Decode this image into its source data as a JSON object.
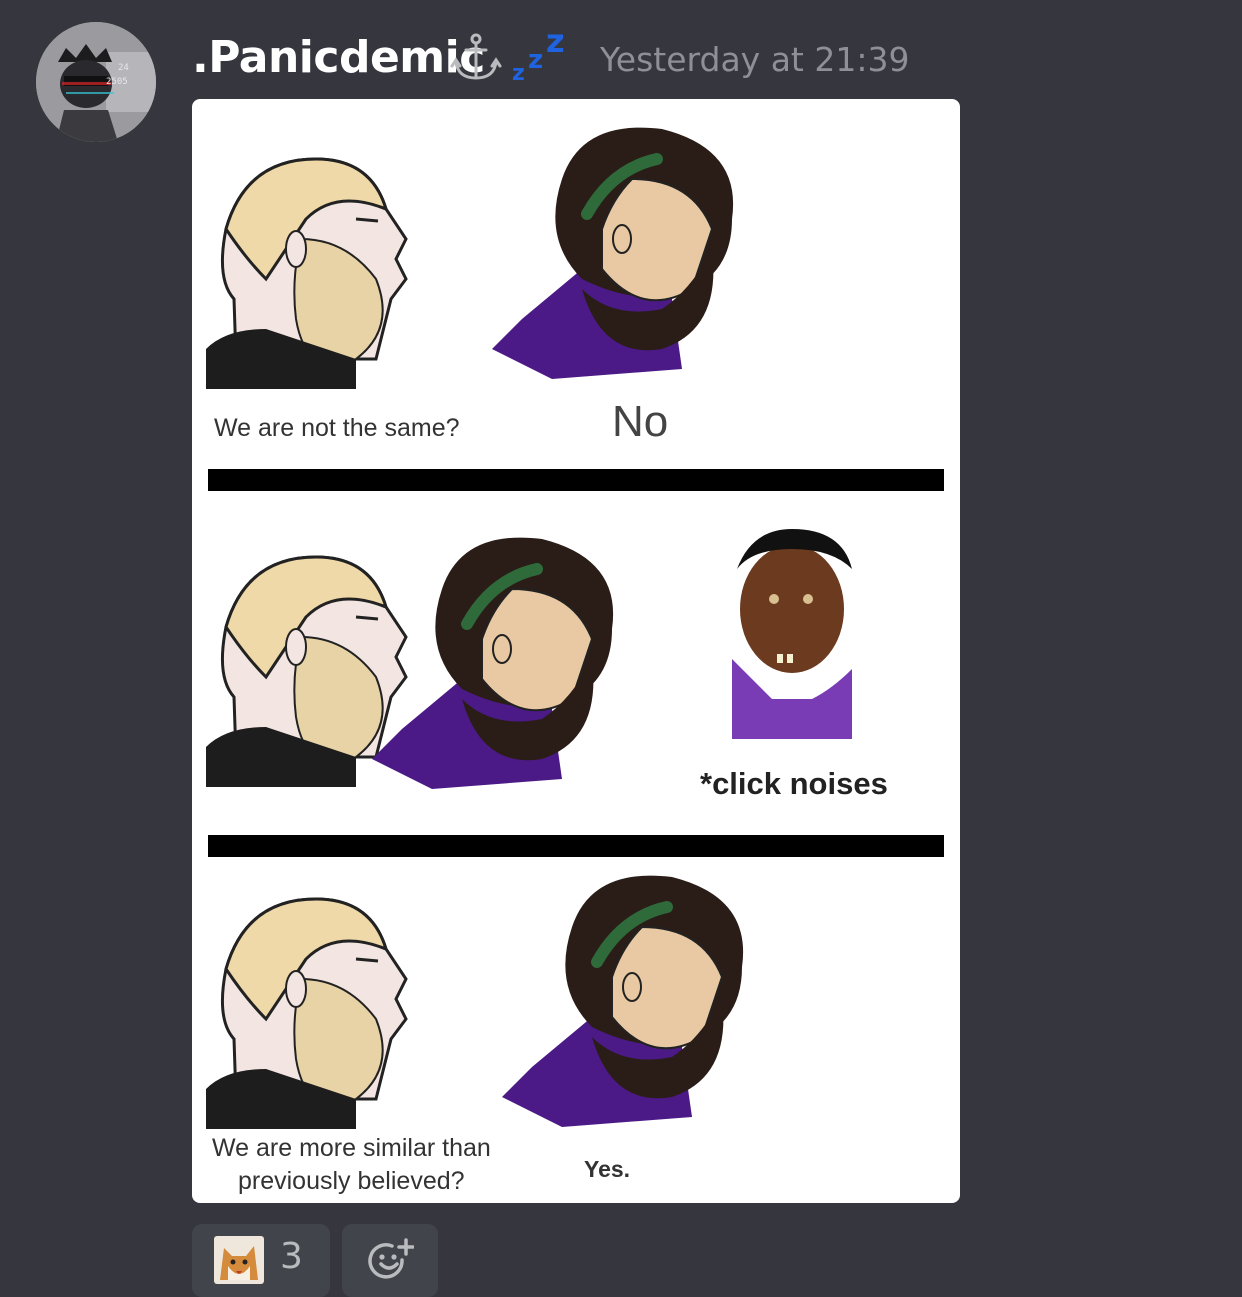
{
  "message": {
    "username": ".Panicdemic",
    "timestamp": "Yesterday at 21:39",
    "status_icons": [
      "anchor-icon",
      "sleeping-zzz-icon"
    ],
    "avatar_text": [
      "24",
      "2505"
    ],
    "meme": {
      "panel1": {
        "left_caption": "We are not the same?",
        "right_caption": "No"
      },
      "panel2": {
        "caption": "*click noises"
      },
      "panel3": {
        "left_caption_line1": "We are more similar than",
        "left_caption_line2": "previously believed?",
        "right_caption": "Yes."
      }
    },
    "reactions": [
      {
        "emoji": "shiba-dog-emoji",
        "count": "3"
      }
    ],
    "add_reaction_icon": "add-reaction-icon"
  },
  "colors": {
    "background": "#36373e",
    "username": "#ffffff",
    "timestamp": "#8e9097",
    "zzz_blue": "#1f63e0",
    "reaction_bg": "#42444b"
  }
}
